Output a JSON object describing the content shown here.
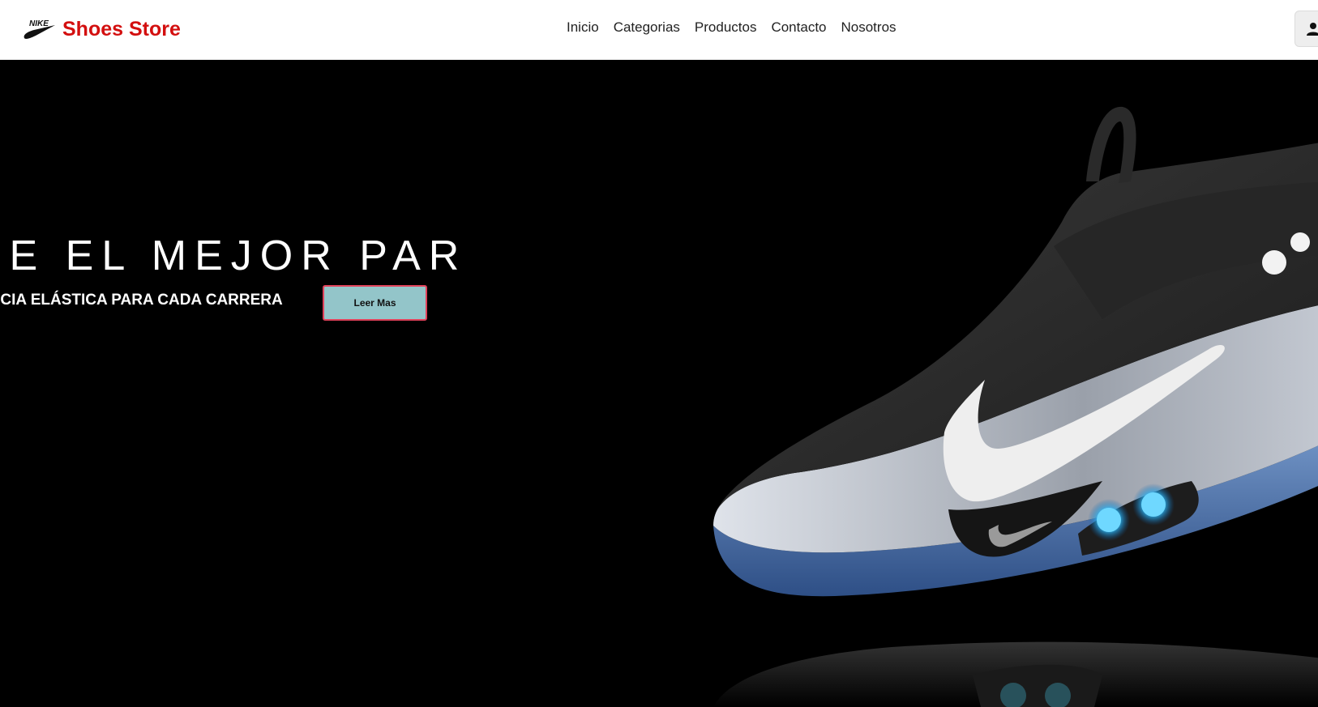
{
  "brand": {
    "logo_icon": "nike-swoosh-icon",
    "logo_text": "NIKE",
    "name": "Shoes Store",
    "name_color": "#d30f0f"
  },
  "nav": {
    "items": [
      {
        "label": "Inicio"
      },
      {
        "label": "Categorias"
      },
      {
        "label": "Productos"
      },
      {
        "label": "Contacto"
      },
      {
        "label": "Nosotros"
      }
    ]
  },
  "user_button": {
    "icon": "user-icon"
  },
  "hero": {
    "title": "UE EL MEJOR PAR",
    "subtitle": "ENCIA ELÁSTICA PARA CADA CARRERA",
    "button_label": "Leer Mas",
    "background_color": "#000000",
    "button_color": "#93c5c9",
    "button_border_color": "#e0425a",
    "image": "nike-sneaker-image"
  }
}
